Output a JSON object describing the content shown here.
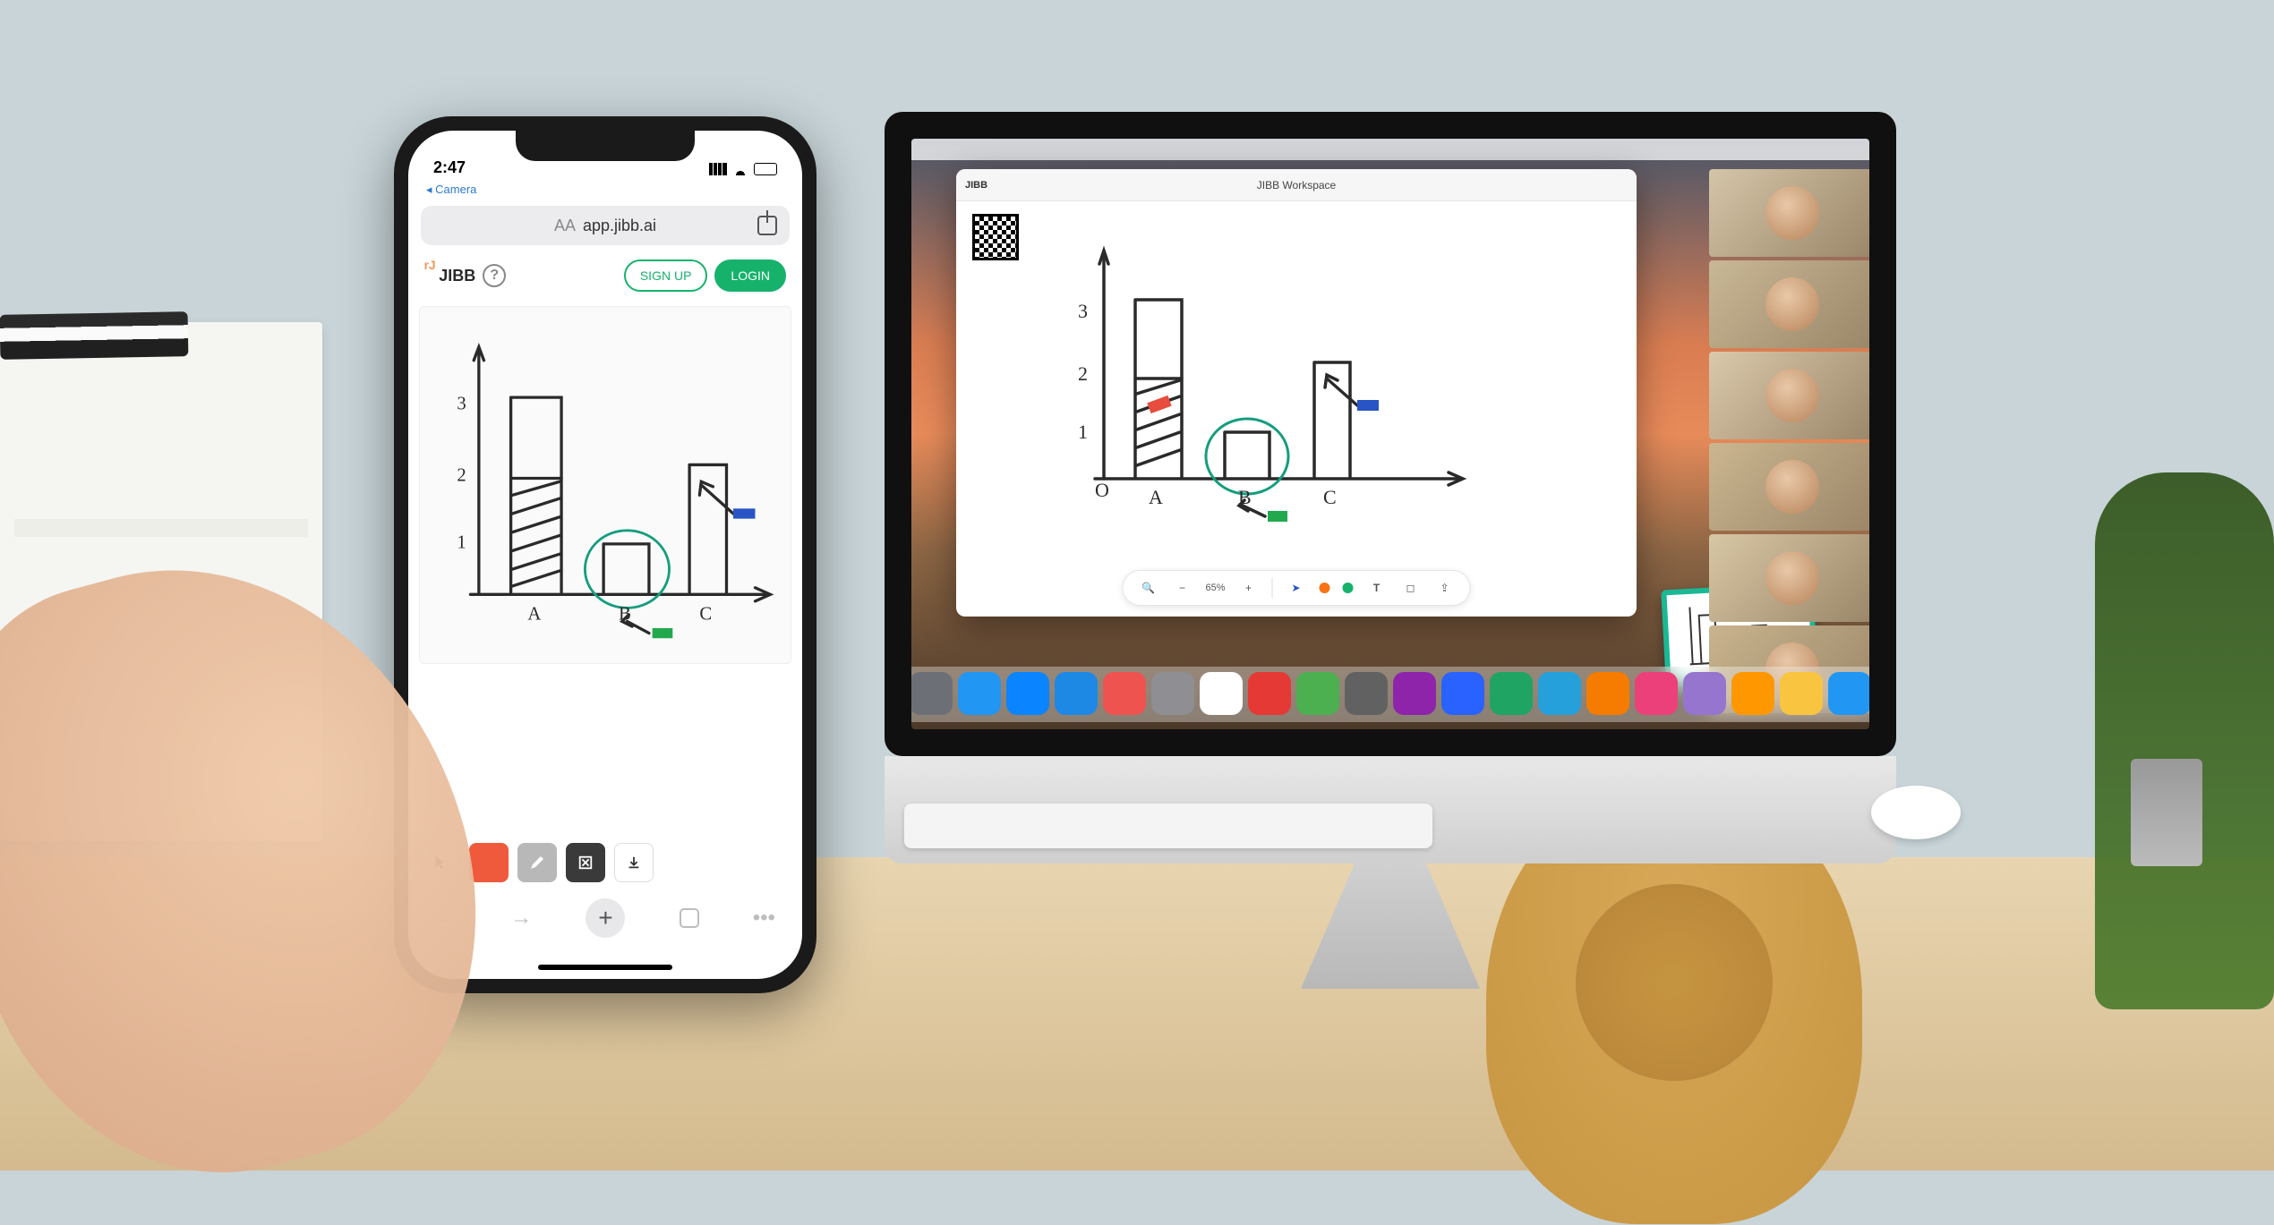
{
  "phone": {
    "status_time": "2:47",
    "back_label": "◂ Camera",
    "url": "app.jibb.ai",
    "logo_text": "JIBB",
    "help_symbol": "?",
    "signup_label": "SIGN UP",
    "login_label": "LOGIN",
    "tools": {
      "cursor": "cursor-tool",
      "color": "color-swatch",
      "pen": "pen-tool",
      "erase": "erase-tool",
      "download": "download-tool"
    }
  },
  "desktop": {
    "window_title": "JIBB Workspace",
    "logo_text": "JIBB",
    "toolbar": {
      "zoom_out": "−",
      "zoom_value": "65%",
      "zoom_in": "+",
      "cursor": "pointer",
      "pen_color": "#16b26c",
      "text_tool": "T"
    },
    "dock_icons": [
      "#2e6fdb",
      "#4a8cf0",
      "#6d6f76",
      "#2196f3",
      "#0a84ff",
      "#1e88e5",
      "#ef5350",
      "#8e8e93",
      "#ffffff",
      "#e53935",
      "#4caf50",
      "#616161",
      "#8e24aa",
      "#2962ff",
      "#1fa463",
      "#25a0da",
      "#f57c00",
      "#ec407a",
      "#9575cd",
      "#ff9800",
      "#f9c440",
      "#2196f3",
      "#78909c",
      "#546e7a"
    ]
  },
  "video_tiles": [
    {
      "bg": "#d5c5a8"
    },
    {
      "bg": "#c9b896"
    },
    {
      "bg": "#dbc9ab"
    },
    {
      "bg": "#cbb690"
    },
    {
      "bg": "#d8c7a5"
    },
    {
      "bg": "#c9b48e"
    }
  ],
  "chart_data": {
    "type": "bar",
    "categories": [
      "A",
      "B",
      "C"
    ],
    "values": [
      3.2,
      1.0,
      2.2
    ],
    "y_ticks": [
      "1",
      "2",
      "3"
    ],
    "x_origin_label": "O",
    "ylim": [
      0,
      3.5
    ],
    "annotations": {
      "bar_A_hatched_above": 2,
      "bar_B_circled_color": "#159d7e",
      "bar_C_arrow_color": "#2854c5",
      "below_B_arrow_color": "#22a94e"
    }
  }
}
